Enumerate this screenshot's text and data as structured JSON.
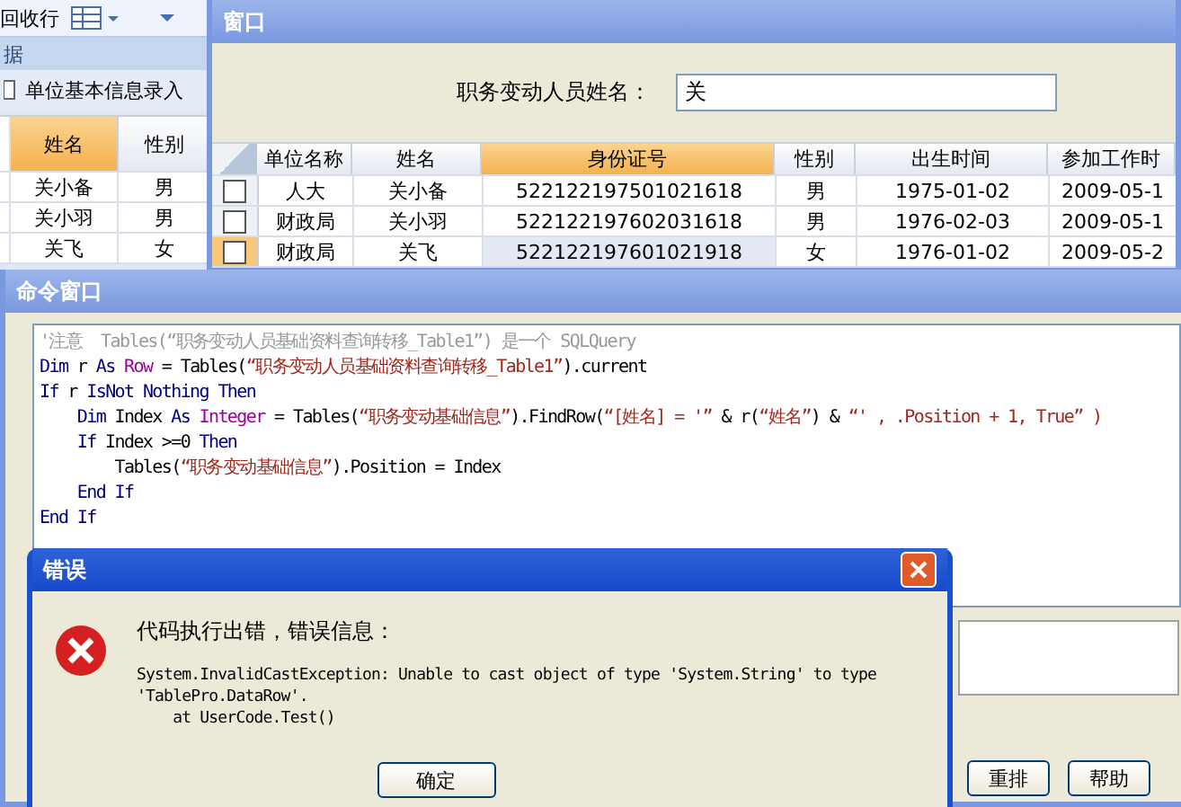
{
  "background_app": {
    "toolbar_label": "回收行",
    "section_label": "据",
    "nav_item": "单位基本信息录入",
    "table": {
      "columns": [
        {
          "label": "姓名",
          "selected": true
        },
        {
          "label": "性别",
          "selected": false
        }
      ],
      "rows": [
        [
          "关小备",
          "男"
        ],
        [
          "关小羽",
          "男"
        ],
        [
          "关飞",
          "女"
        ]
      ]
    }
  },
  "query_window": {
    "title": "窗口",
    "field_label": "职务变动人员姓名：",
    "field_value": "关",
    "table": {
      "columns": [
        {
          "label": "单位名称",
          "selected": false
        },
        {
          "label": "姓名",
          "selected": false
        },
        {
          "label": "身份证号",
          "selected": true
        },
        {
          "label": "性别",
          "selected": false
        },
        {
          "label": "出生时间",
          "selected": false
        },
        {
          "label": "参加工作时",
          "selected": false
        }
      ],
      "rows": [
        {
          "checked": false,
          "selected": false,
          "cells": [
            "人大",
            "关小备",
            "522122197501021618",
            "男",
            "1975-01-02",
            "2009-05-1"
          ]
        },
        {
          "checked": false,
          "selected": false,
          "cells": [
            "财政局",
            "关小羽",
            "522122197602031618",
            "男",
            "1976-02-03",
            "2009-05-1"
          ]
        },
        {
          "checked": false,
          "selected": true,
          "cells": [
            "财政局",
            "关飞",
            "522122197601021918",
            "女",
            "1976-01-02",
            "2009-05-2"
          ]
        }
      ]
    }
  },
  "command_window": {
    "title": "命令窗口",
    "code": [
      [
        {
          "kind": "comment",
          "text": "'注意  Tables(“职务变动人员基础资料查询转移_Table1”) 是一个 SQLQuery"
        }
      ],
      [
        {
          "kind": "keyword",
          "text": "Dim"
        },
        {
          "kind": "plain",
          "text": " r "
        },
        {
          "kind": "keyword",
          "text": "As "
        },
        {
          "kind": "type",
          "text": "Row"
        },
        {
          "kind": "plain",
          "text": " = Tables("
        },
        {
          "kind": "string",
          "text": "“职务变动人员基础资料查询转移_Table1”"
        },
        {
          "kind": "plain",
          "text": ").current"
        }
      ],
      [
        {
          "kind": "keyword",
          "text": "If"
        },
        {
          "kind": "plain",
          "text": " r "
        },
        {
          "kind": "keyword",
          "text": "IsNot Nothing Then"
        }
      ],
      [
        {
          "kind": "keyword",
          "text": "    Dim"
        },
        {
          "kind": "plain",
          "text": " Index "
        },
        {
          "kind": "keyword",
          "text": "As "
        },
        {
          "kind": "type",
          "text": "Integer"
        },
        {
          "kind": "plain",
          "text": " = Tables("
        },
        {
          "kind": "string",
          "text": "“职务变动基础信息”"
        },
        {
          "kind": "plain",
          "text": ").FindRow("
        },
        {
          "kind": "string",
          "text": "“[姓名] = '”"
        },
        {
          "kind": "plain",
          "text": " & r("
        },
        {
          "kind": "string",
          "text": "“姓名”"
        },
        {
          "kind": "plain",
          "text": ") & "
        },
        {
          "kind": "string",
          "text": "“' , .Position + 1, True” )"
        }
      ],
      [
        {
          "kind": "keyword",
          "text": "    If"
        },
        {
          "kind": "plain",
          "text": " Index >=0 "
        },
        {
          "kind": "keyword",
          "text": "Then"
        }
      ],
      [
        {
          "kind": "plain",
          "text": "        Tables("
        },
        {
          "kind": "string",
          "text": "“职务变动基础信息”"
        },
        {
          "kind": "plain",
          "text": ").Position = Index"
        }
      ],
      [
        {
          "kind": "keyword",
          "text": "    End If"
        }
      ],
      [
        {
          "kind": "keyword",
          "text": "End If"
        }
      ]
    ],
    "buttons": [
      "重排",
      "帮助"
    ]
  },
  "error_dialog": {
    "title": "错误",
    "message": "代码执行出错，错误信息：",
    "details": "System.InvalidCastException: Unable to cast object of type 'System.String' to type\n'TablePro.DataRow'.\n    at UserCode.Test()",
    "button": "确定"
  }
}
